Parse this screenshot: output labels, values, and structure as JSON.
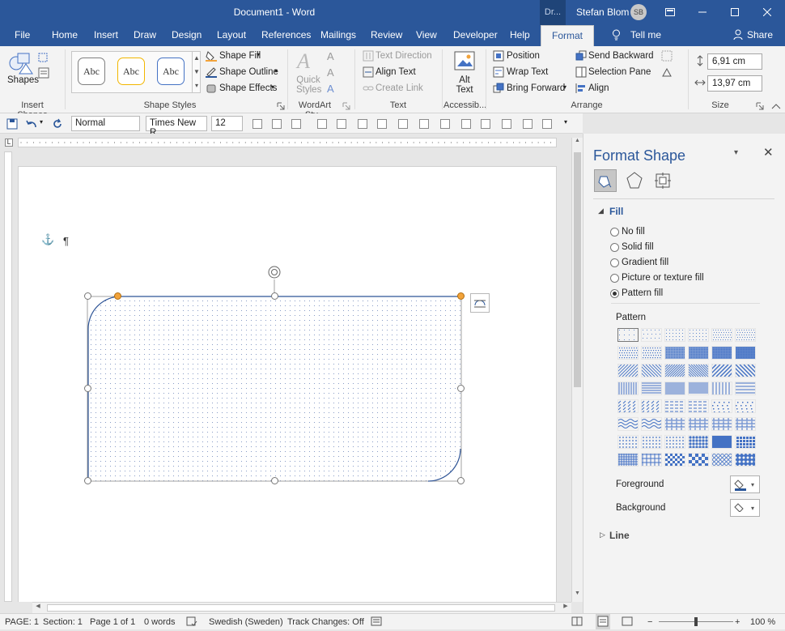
{
  "titlebar": {
    "title": "Document1  -  Word",
    "context_tab": "Dr...",
    "user": "Stefan Blom",
    "avatar_initials": "SB"
  },
  "tabs": [
    "File",
    "Home",
    "Insert",
    "Draw",
    "Design",
    "Layout",
    "References",
    "Mailings",
    "Review",
    "View",
    "Developer",
    "Help",
    "Format"
  ],
  "tell_me": "Tell me",
  "share": "Share",
  "ribbon": {
    "insert_shapes": {
      "shapes_label": "Shapes",
      "group": "Insert Shapes"
    },
    "shape_styles": {
      "samples": [
        "Abc",
        "Abc",
        "Abc"
      ],
      "fill": "Shape Fill",
      "outline": "Shape Outline",
      "effects": "Shape Effects",
      "group": "Shape Styles"
    },
    "wordart": {
      "quick_styles": "Quick Styles",
      "group": "WordArt Sty..."
    },
    "text": {
      "direction": "Text Direction",
      "align": "Align Text",
      "link": "Create Link",
      "group": "Text"
    },
    "accessibility": {
      "alt_text": "Alt Text",
      "group": "Accessib..."
    },
    "arrange": {
      "position": "Position",
      "wrap": "Wrap Text",
      "forward": "Bring Forward",
      "backward": "Send Backward",
      "selection_pane": "Selection Pane",
      "align": "Align",
      "group": "Arrange"
    },
    "size": {
      "height": "6,91 cm",
      "width": "13,97 cm",
      "group": "Size"
    }
  },
  "qat": {
    "style": "Normal",
    "font": "Times New R",
    "size": "12"
  },
  "document": {
    "paragraph_mark": "¶"
  },
  "pane": {
    "title": "Format Shape",
    "section_fill": "Fill",
    "fill_options": [
      {
        "label": "No fill",
        "selected": false
      },
      {
        "label": "Solid fill",
        "selected": false
      },
      {
        "label": "Gradient fill",
        "selected": false
      },
      {
        "label": "Picture or texture fill",
        "selected": false
      },
      {
        "label": "Pattern fill",
        "selected": true
      }
    ],
    "pattern_label": "Pattern",
    "foreground_label": "Foreground",
    "background_label": "Background",
    "section_line": "Line",
    "accent": "#2b579a",
    "pattern_color": "#4472c4"
  },
  "status": {
    "page": "PAGE: 1",
    "section": "Section: 1",
    "page_of": "Page 1 of 1",
    "words": "0 words",
    "language": "Swedish (Sweden)",
    "track_changes": "Track Changes: Off",
    "zoom": "100 %"
  }
}
